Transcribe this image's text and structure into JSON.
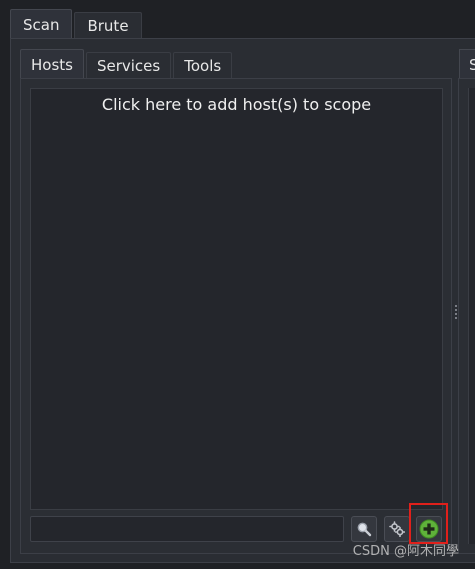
{
  "main_tabs": [
    {
      "label": "Scan",
      "active": true
    },
    {
      "label": "Brute",
      "active": false
    }
  ],
  "sub_tabs": [
    {
      "label": "Hosts",
      "active": true
    },
    {
      "label": "Services",
      "active": false
    },
    {
      "label": "Tools",
      "active": false
    }
  ],
  "right_panel": {
    "tab_label": "S"
  },
  "hosts": {
    "empty_hint": "Click here to add host(s) to scope",
    "filter_value": ""
  },
  "toolbar": {
    "search_icon": "magnifier-icon",
    "settings_icon": "gears-icon",
    "add_icon": "plus-circle-icon",
    "add_color": "#5fb23a"
  },
  "highlight": {
    "color": "#e0201b"
  },
  "watermark": "CSDN @阿木同學"
}
